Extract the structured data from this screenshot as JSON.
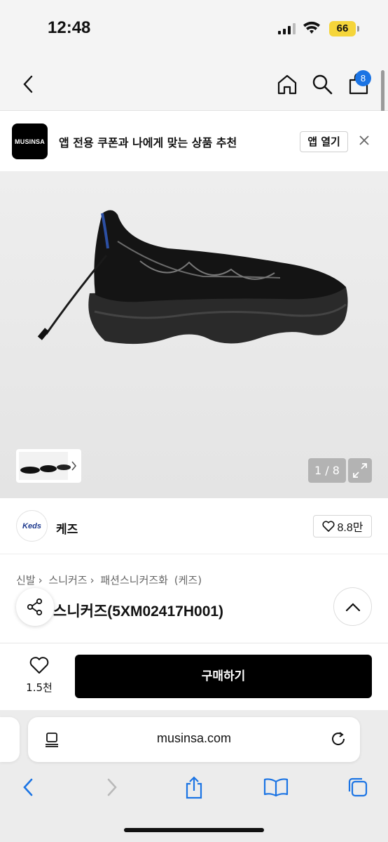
{
  "status_bar": {
    "time": "12:48",
    "battery": "66"
  },
  "header": {
    "cart_count": "8",
    "icons": [
      "back-icon",
      "home-icon",
      "search-icon",
      "shopping-bag-icon"
    ]
  },
  "app_banner": {
    "logo_text": "MUSINSA",
    "message": "앱 전용 쿠폰과 나에게 맞는 상품 추천",
    "open_button": "앱 열기"
  },
  "gallery": {
    "counter": "1 / 8"
  },
  "brand": {
    "logo_text": "Keds",
    "name": "케즈",
    "likes": "8.8만"
  },
  "product": {
    "breadcrumb": [
      "신발",
      "스니커즈",
      "패션스니커즈화",
      "(케즈)"
    ],
    "title": "스니커즈(5XM02417H001)"
  },
  "bottom_bar": {
    "wish_count": "1.5천",
    "buy_label": "구매하기"
  },
  "browser": {
    "url": "musinsa.com"
  },
  "colors": {
    "accent": "#1b74e4",
    "buy_button": "#000000",
    "battery": "#f5d53a"
  }
}
